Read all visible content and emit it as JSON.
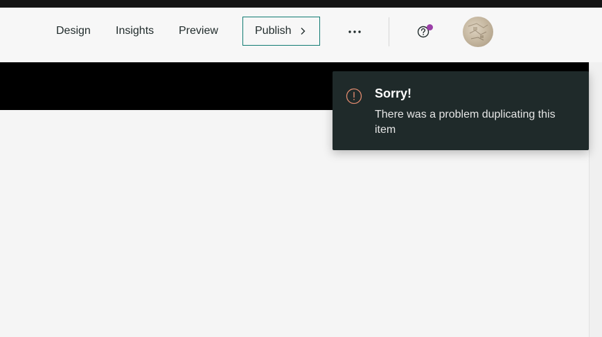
{
  "nav": {
    "design": "Design",
    "insights": "Insights",
    "preview": "Preview",
    "publish": "Publish"
  },
  "icons": {
    "more": "more-horizontal-icon",
    "help": "help-circle-icon",
    "chevron": "chevron-right-icon",
    "alert": "alert-circle-icon"
  },
  "toast": {
    "title": "Sorry!",
    "message": "There was a problem duplicating this item"
  },
  "colors": {
    "accent": "#0f7a72",
    "notification_dot": "#9b3fa8",
    "toast_background": "#1f2a2a",
    "alert_icon": "#e08a6e"
  }
}
